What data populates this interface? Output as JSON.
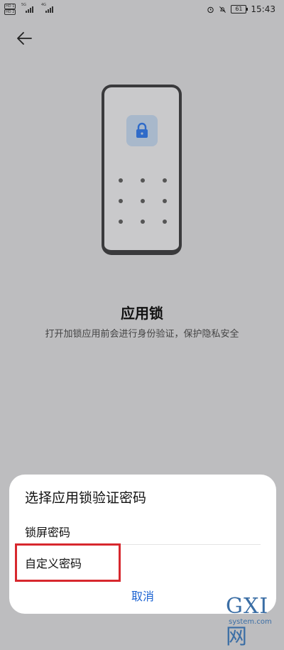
{
  "status_bar": {
    "sim1_label": "HD 1",
    "sim2_label": "HD 2",
    "net1_label": "5G",
    "net2_label": "4G",
    "battery": "61",
    "time": "15:43"
  },
  "header": {
    "back_icon": "arrow-left-icon"
  },
  "illustration": {
    "lock_icon": "lock-icon",
    "lock_tile_color": "#a8b8cb",
    "lock_color": "#2f6bc9"
  },
  "main": {
    "title": "应用锁",
    "subtitle": "打开加锁应用前会进行身份验证，保护隐私安全"
  },
  "dialog": {
    "title": "选择应用锁验证密码",
    "options": [
      {
        "label": "锁屏密码"
      },
      {
        "label": "自定义密码"
      }
    ],
    "cancel_label": "取消",
    "accent_color": "#1a62d2",
    "highlight_color": "#d7282e"
  },
  "watermark": {
    "logo": "GXI网",
    "site": "system.com"
  }
}
